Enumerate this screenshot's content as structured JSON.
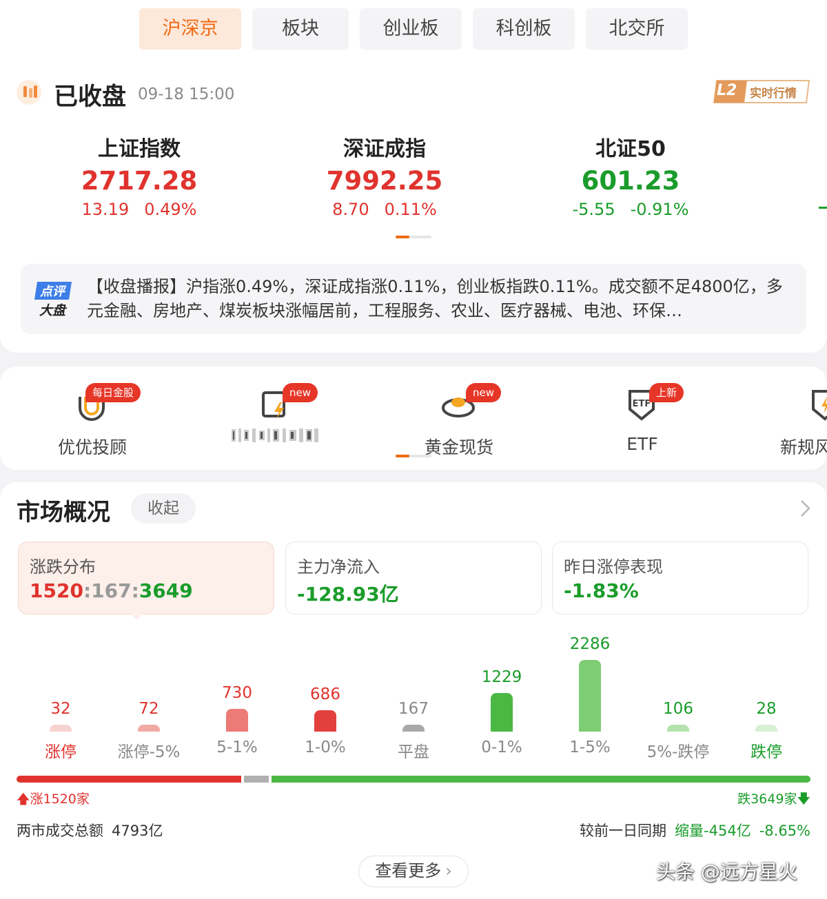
{
  "tabs": [
    {
      "label": "沪深京",
      "active": true
    },
    {
      "label": "板块",
      "active": false
    },
    {
      "label": "创业板",
      "active": false
    },
    {
      "label": "科创板",
      "active": false
    },
    {
      "label": "北交所",
      "active": false
    }
  ],
  "status": {
    "text": "已收盘",
    "time": "09-18 15:00"
  },
  "l2_badge": {
    "code": "L2",
    "label": "实时行情"
  },
  "indices": [
    {
      "name": "上证指数",
      "value": "2717.28",
      "change": "13.19",
      "pct": "0.49%",
      "trend": "up"
    },
    {
      "name": "深证成指",
      "value": "7992.25",
      "change": "8.70",
      "pct": "0.11%",
      "trend": "up"
    },
    {
      "name": "北证50",
      "value": "601.23",
      "change": "-5.55",
      "pct": "-0.91%",
      "trend": "down"
    }
  ],
  "report": {
    "logo_top": "点评",
    "logo_bottom": "大盘",
    "text": "【收盘播报】沪指涨0.49%，深证成指涨0.11%，创业板指跌0.11%。成交额不足4800亿，多元金融、房地产、煤炭板块涨幅居前，工程服务、农业、医疗器械、电池、环保…"
  },
  "services": [
    {
      "label": "优优投顾",
      "badge": "每日金股",
      "icon": "magnet-icon"
    },
    {
      "label": "",
      "badge": "new",
      "icon": "flash-book-icon"
    },
    {
      "label": "黄金现货",
      "badge": "new",
      "icon": "gold-ingot-icon"
    },
    {
      "label": "ETF",
      "badge": "上新",
      "icon": "etf-shield-icon"
    },
    {
      "label": "新规风",
      "badge": "",
      "icon": "shield-icon"
    }
  ],
  "market": {
    "title": "市场概况",
    "collapse_label": "收起",
    "cards": [
      {
        "label": "涨跌分布",
        "up": "1520",
        "flat": "167",
        "down": "3649"
      },
      {
        "label": "主力净流入",
        "value": "-128.93亿"
      },
      {
        "label": "昨日涨停表现",
        "value": "-1.83%"
      }
    ],
    "up_total": "涨1520家",
    "down_total": "跌3649家",
    "turnover_label": "两市成交总额",
    "turnover_value": "4793亿",
    "compare_label": "较前一日同期",
    "compare_volume": "缩量-454亿",
    "compare_pct": "-8.65%",
    "more_label": "查看更多"
  },
  "chart_data": {
    "type": "bar",
    "categories": [
      "涨停",
      "涨停-5%",
      "5-1%",
      "1-0%",
      "平盘",
      "0-1%",
      "1-5%",
      "5%-跌停",
      "跌停"
    ],
    "values": [
      32,
      72,
      730,
      686,
      167,
      1229,
      2286,
      106,
      28
    ],
    "colors": [
      "#f7d3d0",
      "#f2a9a4",
      "#ec7a76",
      "#e2403c",
      "#a8a8a8",
      "#4cb844",
      "#7dcd74",
      "#b3e2ac",
      "#d8f0d4"
    ],
    "count_colors": [
      "#e0332e",
      "#e0332e",
      "#e0332e",
      "#e0332e",
      "#888888",
      "#1a9c2a",
      "#1a9c2a",
      "#1a9c2a",
      "#1a9c2a"
    ],
    "label_colors": [
      "#e0332e",
      "#888888",
      "#888888",
      "#888888",
      "#888888",
      "#888888",
      "#888888",
      "#888888",
      "#1a9c2a"
    ],
    "ratio": {
      "up": 1520,
      "flat": 167,
      "down": 3649
    }
  },
  "watermark": "头条 @远方星火",
  "colors": {
    "accent": "#f06a12",
    "up": "#e0332e",
    "down": "#1a9c2a"
  }
}
